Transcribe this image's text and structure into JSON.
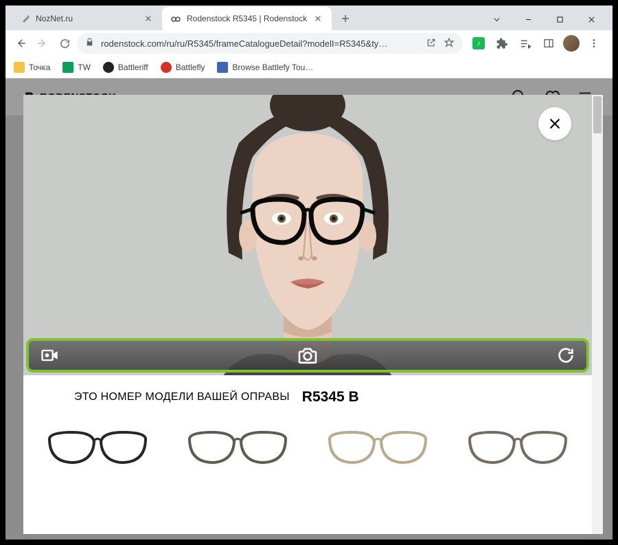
{
  "window": {
    "tabs": [
      {
        "title": "NozNet.ru",
        "active": false
      },
      {
        "title": "Rodenstock R5345 | Rodenstock",
        "active": true
      }
    ]
  },
  "toolbar": {
    "url": "rodenstock.com/ru/ru/R5345/frameCatalogueDetail?modelI=R5345&ty…"
  },
  "bookmarks": [
    {
      "label": "Точка",
      "color": "#f6c344"
    },
    {
      "label": "TW",
      "color": "#0f9d58"
    },
    {
      "label": "Battleriff",
      "color": "#222"
    },
    {
      "label": "Battlefly",
      "color": "#d93025"
    },
    {
      "label": "Browse Battlefy Tou…",
      "color": "#3b5998"
    }
  ],
  "site": {
    "brand": "RODENSTOCK"
  },
  "modal": {
    "model_label": "ЭТО НОМЕР МОДЕЛИ ВАШЕЙ ОПРАВЫ",
    "model_code": "R5345 B",
    "controls": {
      "video": "video-icon",
      "capture": "camera-icon",
      "refresh": "refresh-icon"
    },
    "thumbnail_colors": [
      "#262626",
      "#605a50",
      "#b9a98d",
      "#746b63"
    ]
  }
}
